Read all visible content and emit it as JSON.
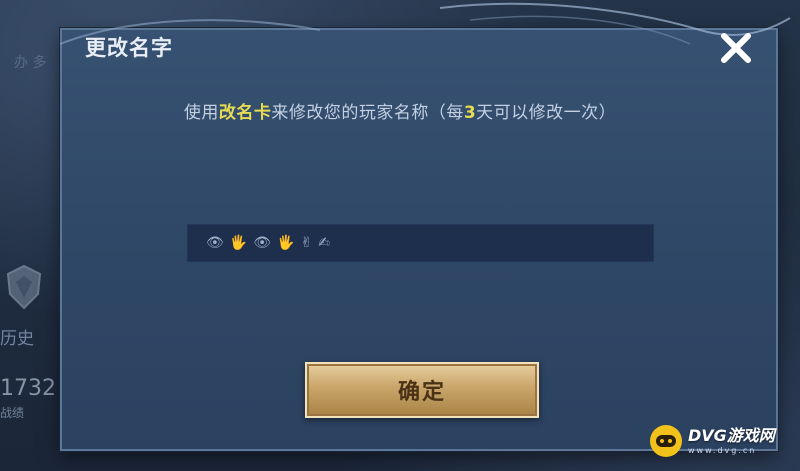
{
  "background": {
    "history_label": "历史",
    "number": "1732",
    "sub_label": "战绩",
    "top_label": "办 多"
  },
  "dialog": {
    "title": "更改名字",
    "close_icon": "close-x-icon",
    "instruction": {
      "part1": "使用",
      "highlight1": "改名卡",
      "part2": "来修改您的玩家名称（每",
      "highlight2": "3",
      "part3": "天可以修改一次）"
    },
    "name_input": {
      "value_glyphs": [
        "👁",
        "🖐",
        "👁",
        "🖐",
        "✌",
        "✍"
      ]
    },
    "confirm_label": "确定"
  },
  "watermark": {
    "brand": "DVG游戏网",
    "url": "www.dvg.cn"
  },
  "colors": {
    "highlight": "#e6dc52",
    "dialog_bg": "#2f4766",
    "button_gold": "#c9a56a"
  }
}
